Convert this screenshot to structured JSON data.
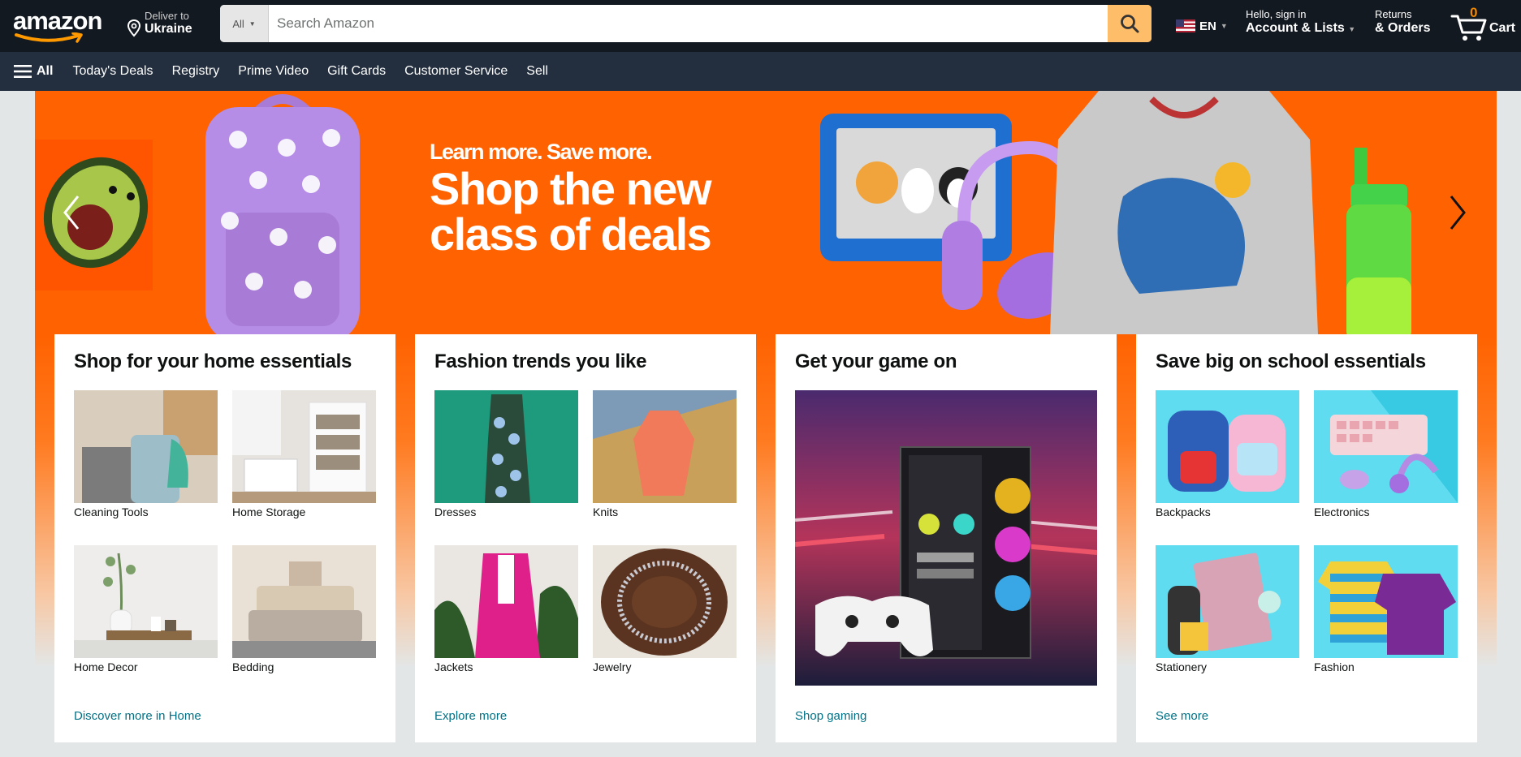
{
  "header": {
    "logo_text": "amazon",
    "deliver_line1": "Deliver to",
    "deliver_line2": "Ukraine",
    "search_category": "All",
    "search_placeholder": "Search Amazon",
    "language": "EN",
    "account_line1": "Hello, sign in",
    "account_line2": "Account & Lists",
    "returns_line1": "Returns",
    "returns_line2": "& Orders",
    "cart_count": "0",
    "cart_label": "Cart"
  },
  "subnav": {
    "all_label": "All",
    "items": [
      "Today's Deals",
      "Registry",
      "Prime Video",
      "Gift Cards",
      "Customer Service",
      "Sell"
    ]
  },
  "hero": {
    "line_small": "Learn more. Save more.",
    "line_big1": "Shop the new",
    "line_big2": "class of deals"
  },
  "cards": [
    {
      "title": "Shop for your home essentials",
      "tiles": [
        "Cleaning Tools",
        "Home Storage",
        "Home Decor",
        "Bedding"
      ],
      "link": "Discover more in Home"
    },
    {
      "title": "Fashion trends you like",
      "tiles": [
        "Dresses",
        "Knits",
        "Jackets",
        "Jewelry"
      ],
      "link": "Explore more"
    },
    {
      "title": "Get your game on",
      "link": "Shop gaming"
    },
    {
      "title": "Save big on school essentials",
      "tiles": [
        "Backpacks",
        "Electronics",
        "Stationery",
        "Fashion"
      ],
      "link": "See more"
    }
  ],
  "colors": {
    "nav_bg": "#131921",
    "subnav_bg": "#232f3e",
    "search_btn": "#febd69",
    "hero_orange": "#ff6200",
    "link": "#007185",
    "cart_count": "#f08804"
  }
}
